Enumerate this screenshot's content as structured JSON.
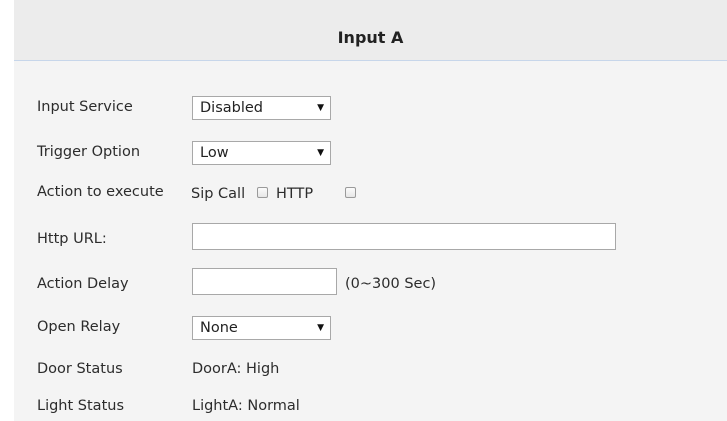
{
  "header": {
    "title": "Input A"
  },
  "form": {
    "input_service": {
      "label": "Input Service",
      "value": "Disabled"
    },
    "trigger_option": {
      "label": "Trigger Option",
      "value": "Low"
    },
    "action_to_execute": {
      "label": "Action to execute",
      "sip_call_label": "Sip Call",
      "sip_call_checked": false,
      "http_label": "HTTP",
      "http_checked": false
    },
    "http_url": {
      "label": "Http URL:",
      "value": ""
    },
    "action_delay": {
      "label": "Action Delay",
      "value": "",
      "unit_hint": "(0~300 Sec)"
    },
    "open_relay": {
      "label": "Open Relay",
      "value": "None"
    },
    "door_status": {
      "label": "Door Status",
      "value": "DoorA: High"
    },
    "light_status": {
      "label": "Light Status",
      "value": "LightA: Normal"
    }
  },
  "icons": {
    "dropdown": "triangle-down-icon",
    "checkbox": "checkbox-icon"
  }
}
